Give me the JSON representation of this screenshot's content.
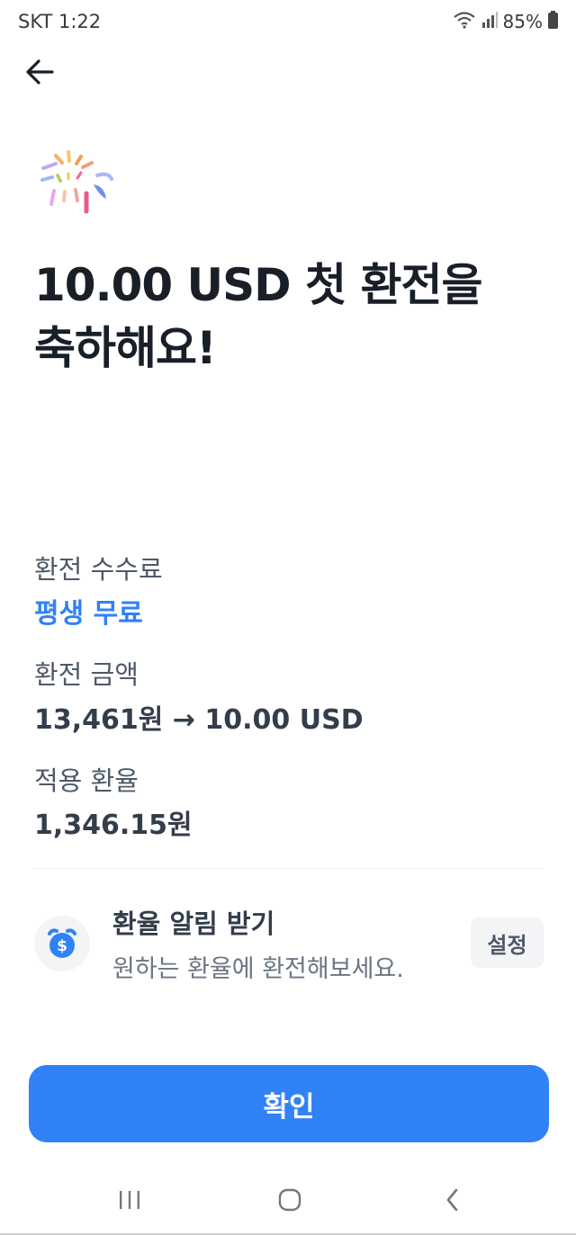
{
  "status_bar": {
    "carrier_time": "SKT 1:22",
    "battery": "85%"
  },
  "headline": {
    "line1": "10.00 USD 첫 환전을",
    "line2": "축하해요!"
  },
  "info": {
    "fee_label": "환전 수수료",
    "fee_value": "평생 무료",
    "amount_label": "환전 금액",
    "amount_value": "13,461원 → 10.00 USD",
    "rate_label": "적용 환율",
    "rate_value": "1,346.15원"
  },
  "rate_alert": {
    "title": "환율 알림 받기",
    "description": "원하는 환율에 환전해보세요.",
    "button": "설정",
    "icon": "alarm-clock-dollar-icon"
  },
  "confirm_button": "확인",
  "colors": {
    "accent": "#3182f6",
    "text_primary": "#191f28",
    "text_secondary": "#4e5968",
    "surface": "#f2f4f6"
  },
  "icons": {
    "back": "arrow-left-icon",
    "confetti": "confetti-icon",
    "wifi": "wifi-icon",
    "signal": "signal-icon",
    "battery": "battery-icon",
    "nav_recents": "recents-icon",
    "nav_home": "home-icon",
    "nav_back": "back-chevron-icon"
  }
}
